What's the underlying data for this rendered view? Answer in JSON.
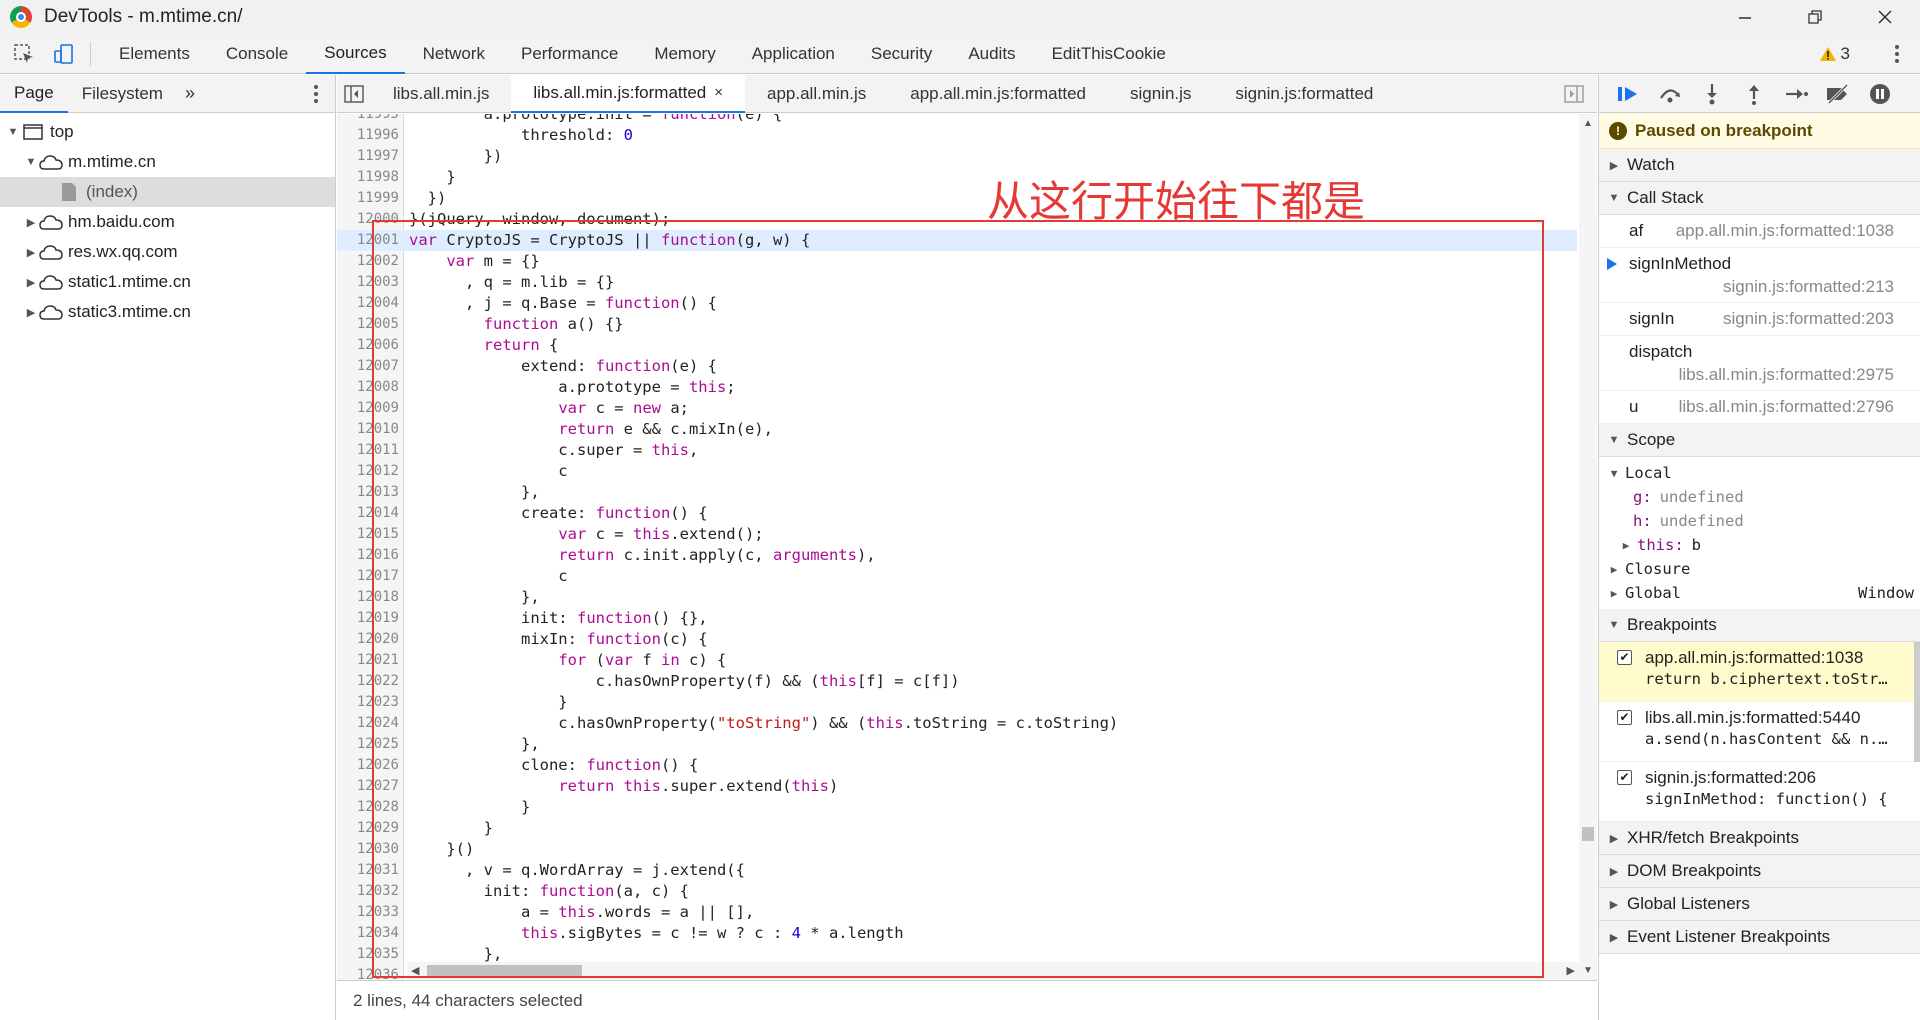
{
  "window": {
    "title": "DevTools - m.mtime.cn/"
  },
  "toolbar": {
    "tabs": [
      "Elements",
      "Console",
      "Sources",
      "Network",
      "Performance",
      "Memory",
      "Application",
      "Security",
      "Audits",
      "EditThisCookie"
    ],
    "active_tab": "Sources",
    "warnings": "3"
  },
  "navigator": {
    "tabs": [
      "Page",
      "Filesystem"
    ],
    "more": "»",
    "tree": {
      "top": "top",
      "domain": "m.mtime.cn",
      "file": "(index)",
      "others": [
        "hm.baidu.com",
        "res.wx.qq.com",
        "static1.mtime.cn",
        "static3.mtime.cn"
      ]
    }
  },
  "editor": {
    "tabs": [
      "libs.all.min.js",
      "libs.all.min.js:formatted",
      "app.all.min.js",
      "app.all.min.js:formatted",
      "signin.js",
      "signin.js:formatted"
    ],
    "active_tab": "libs.all.min.js:formatted",
    "close": "×",
    "lines": [
      {
        "n": "11995",
        "t": "        a.prototype.init = function(e) {"
      },
      {
        "n": "11996",
        "t": "            threshold: 0"
      },
      {
        "n": "11997",
        "t": "        })"
      },
      {
        "n": "11998",
        "t": "    }"
      },
      {
        "n": "11999",
        "t": "  })"
      },
      {
        "n": "12000",
        "t": "}(jQuery, window, document);"
      },
      {
        "n": "12001",
        "t": "var CryptoJS = CryptoJS || function(g, w) {"
      },
      {
        "n": "12002",
        "t": "    var m = {}"
      },
      {
        "n": "12003",
        "t": "      , q = m.lib = {}"
      },
      {
        "n": "12004",
        "t": "      , j = q.Base = function() {"
      },
      {
        "n": "12005",
        "t": "        function a() {}"
      },
      {
        "n": "12006",
        "t": "        return {"
      },
      {
        "n": "12007",
        "t": "            extend: function(e) {"
      },
      {
        "n": "12008",
        "t": "                a.prototype = this;"
      },
      {
        "n": "12009",
        "t": "                var c = new a;"
      },
      {
        "n": "12010",
        "t": "                return e && c.mixIn(e),"
      },
      {
        "n": "12011",
        "t": "                c.$super = this,"
      },
      {
        "n": "12012",
        "t": "                c"
      },
      {
        "n": "12013",
        "t": "            },"
      },
      {
        "n": "12014",
        "t": "            create: function() {"
      },
      {
        "n": "12015",
        "t": "                var c = this.extend();"
      },
      {
        "n": "12016",
        "t": "                return c.init.apply(c, arguments),"
      },
      {
        "n": "12017",
        "t": "                c"
      },
      {
        "n": "12018",
        "t": "            },"
      },
      {
        "n": "12019",
        "t": "            init: function() {},"
      },
      {
        "n": "12020",
        "t": "            mixIn: function(c) {"
      },
      {
        "n": "12021",
        "t": "                for (var f in c) {"
      },
      {
        "n": "12022",
        "t": "                    c.hasOwnProperty(f) && (this[f] = c[f])"
      },
      {
        "n": "12023",
        "t": "                }"
      },
      {
        "n": "12024",
        "t": "                c.hasOwnProperty(\"toString\") && (this.toString = c.toString)"
      },
      {
        "n": "12025",
        "t": "            },"
      },
      {
        "n": "12026",
        "t": "            clone: function() {"
      },
      {
        "n": "12027",
        "t": "                return this.$super.extend(this)"
      },
      {
        "n": "12028",
        "t": "            }"
      },
      {
        "n": "12029",
        "t": "        }"
      },
      {
        "n": "12030",
        "t": "    }()"
      },
      {
        "n": "12031",
        "t": "      , v = q.WordArray = j.extend({"
      },
      {
        "n": "12032",
        "t": "        init: function(a, c) {"
      },
      {
        "n": "12033",
        "t": "            a = this.words = a || [],"
      },
      {
        "n": "12034",
        "t": "            this.sigBytes = c != w ? c : 4 * a.length"
      },
      {
        "n": "12035",
        "t": "        },"
      },
      {
        "n": "12036",
        "t": "        toString: function(a) {"
      }
    ],
    "highlighted_line": "12001",
    "status": "2 lines, 44 characters selected",
    "annotation": "从这行开始往下都是"
  },
  "debugger": {
    "paused": "Paused on breakpoint",
    "paused_icon": "!",
    "sections": {
      "watch": "Watch",
      "call_stack": "Call Stack",
      "scope": "Scope",
      "breakpoints": "Breakpoints",
      "xhr": "XHR/fetch Breakpoints",
      "dom": "DOM Breakpoints",
      "global_listeners": "Global Listeners",
      "event_listeners": "Event Listener Breakpoints"
    },
    "call_stack": [
      {
        "fn": "af",
        "loc": "app.all.min.js:formatted:1038"
      },
      {
        "fn": "signInMethod",
        "loc": "signin.js:formatted:213"
      },
      {
        "fn": "signIn",
        "loc": "signin.js:formatted:203"
      },
      {
        "fn": "dispatch",
        "loc": "libs.all.min.js:formatted:2975"
      },
      {
        "fn": "u",
        "loc": "libs.all.min.js:formatted:2796"
      }
    ],
    "scope": {
      "local": "Local",
      "vars": [
        {
          "k": "g:",
          "v": "undefined"
        },
        {
          "k": "h:",
          "v": "undefined"
        }
      ],
      "this_key": "this:",
      "this_val": "b",
      "closure": "Closure",
      "global": "Global",
      "global_val": "Window"
    },
    "breakpoints": [
      {
        "src": "app.all.min.js:formatted:1038",
        "code": "return b.ciphertext.toStr…"
      },
      {
        "src": "libs.all.min.js:formatted:5440",
        "code": "a.send(n.hasContent && n.…"
      },
      {
        "src": "signin.js:formatted:206",
        "code": "signInMethod: function() {"
      }
    ],
    "check": "✔"
  }
}
